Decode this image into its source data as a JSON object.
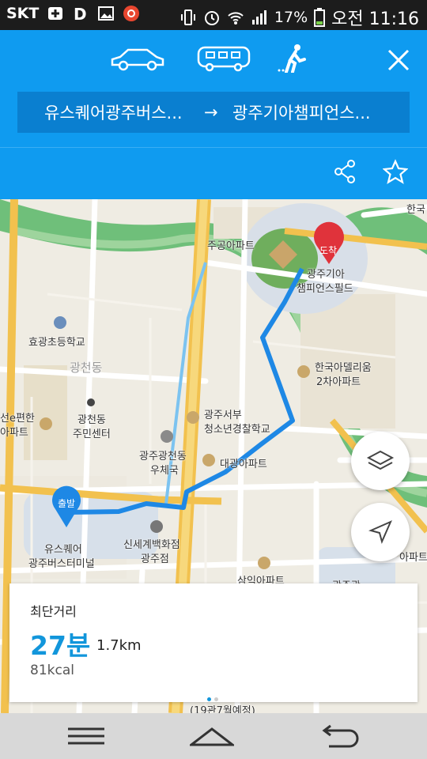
{
  "status": {
    "carrier": "SKT",
    "battery": "17%",
    "time": "오전 11:16"
  },
  "header": {
    "modes": [
      "car-icon",
      "bus-icon",
      "walk-icon"
    ],
    "selected_mode": "walk",
    "from": "유스퀘어광주버스...",
    "arrow": "→",
    "to": "광주기아챔피언스..."
  },
  "map": {
    "labels": {
      "top_right": "한국",
      "jugong": "주공아파트",
      "kia1": "광주기아",
      "kia2": "챔피언스필드",
      "school": "효광초등학교",
      "gwangcheon": "광천동",
      "amelium1": "한국아델리움",
      "amelium2": "2차아파트",
      "left_edge1": "선e편한",
      "left_edge2": "아파트",
      "center1": "광천동",
      "center2": "주민센터",
      "police1": "광주서부",
      "police2": "청소년경찰학교",
      "post1": "광주광천동",
      "post2": "우체국",
      "daegwang": "대광아파트",
      "usquare1": "유스퀘어",
      "usquare2": "광주버스터미널",
      "shinsegae1": "신세계백화점",
      "shinsegae2": "광주점",
      "samik": "삼익아파트",
      "gwangju_right": "광주광",
      "apt_right": "아파트",
      "bottom": "(19관7월예정)",
      "start": "출발",
      "arrival": "도착"
    }
  },
  "info": {
    "title": "최단거리",
    "duration": "27분",
    "distance": "1.7km",
    "calories": "81kcal"
  },
  "colors": {
    "header": "#0f9bf0",
    "route": "#1e88e5",
    "accent": "#1296db",
    "arrival_pin": "#e0333b"
  }
}
